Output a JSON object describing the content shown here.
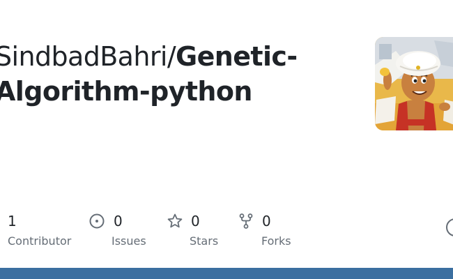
{
  "repo": {
    "owner": "SindbadBahri",
    "separator": "/",
    "name_line1": "Genetic-",
    "name_line2": "Algorithm-python"
  },
  "avatar": {
    "icon": "owner-avatar-cartoon-boy-turban"
  },
  "stats": [
    {
      "value": "1",
      "label": "Contributor",
      "icon": "people-icon"
    },
    {
      "value": "0",
      "label": "Issues",
      "icon": "issue-opened-icon"
    },
    {
      "value": "0",
      "label": "Stars",
      "icon": "star-icon"
    },
    {
      "value": "0",
      "label": "Forks",
      "icon": "repo-forked-icon"
    }
  ],
  "colors": {
    "text": "#1f2328",
    "muted": "#656d76",
    "bottom_bar": "#3b6fa0"
  }
}
